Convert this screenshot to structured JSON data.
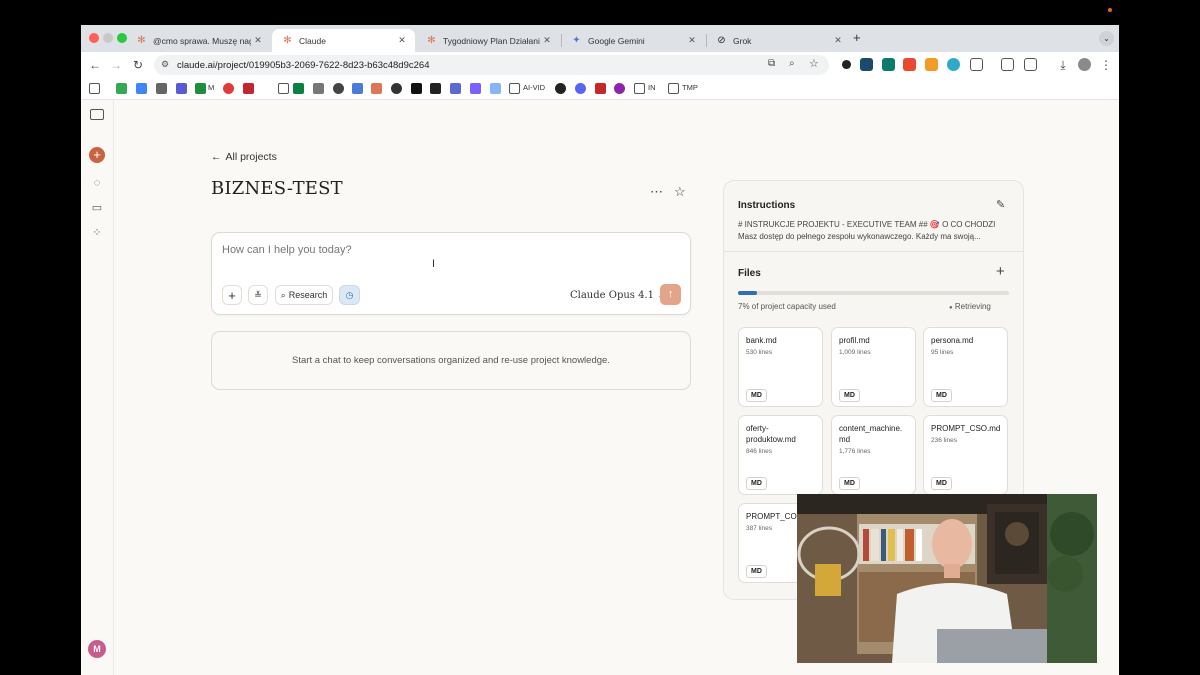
{
  "tabs": [
    {
      "title": "@cmo sprawa. Muszę nagrać",
      "icon": "claude-icon",
      "active": false
    },
    {
      "title": "Claude",
      "icon": "claude-icon",
      "active": true
    },
    {
      "title": "Tygodniowy Plan Działania - C",
      "icon": "claude-icon",
      "active": false
    },
    {
      "title": "Google Gemini",
      "icon": "gemini-icon",
      "active": false
    },
    {
      "title": "Grok",
      "icon": "grok-icon",
      "active": false
    }
  ],
  "new_tab_label": "+",
  "address": {
    "url": "claude.ai/project/019905b3-2069-7622-8d23-b63c48d9c264"
  },
  "bookmarks": {
    "m_label": "M",
    "ai_vid": "AI-VID",
    "in": "IN",
    "tmp": "TMP"
  },
  "project": {
    "back_label": "All projects",
    "title": "BIZNES-TEST",
    "composer_placeholder": "How can I help you today?",
    "research_label": "Research",
    "model_label": "Claude Opus 4.1",
    "empty_state": "Start a chat to keep conversations organized and re-use project knowledge."
  },
  "knowledge": {
    "instructions_title": "Instructions",
    "instructions_line1": "# INSTRUKCJE PROJEKTU - EXECUTIVE TEAM ## 🎯 O CO CHODZI",
    "instructions_line2": "Masz dostęp do pełnego zespołu wykonawczego. Każdy ma swoją...",
    "files_title": "Files",
    "capacity_label": "7% of project capacity used",
    "capacity_fraction": 0.07,
    "retrieving_label": "Retrieving",
    "files": [
      {
        "name": "bank.md",
        "lines": "530 lines",
        "type": "MD"
      },
      {
        "name": "profil.md",
        "lines": "1,009 lines",
        "type": "MD"
      },
      {
        "name": "persona.md",
        "lines": "95 lines",
        "type": "MD"
      },
      {
        "name": "oferty-\nproduktow.md",
        "lines": "846 lines",
        "type": "MD"
      },
      {
        "name": "content_machine.\nmd",
        "lines": "1,776 lines",
        "type": "MD"
      },
      {
        "name": "PROMPT_CSO.md",
        "lines": "236 lines",
        "type": "MD"
      },
      {
        "name": "PROMPT_CO",
        "lines": "387 lines",
        "type": "MD"
      }
    ]
  },
  "colors": {
    "accent": "#c96442",
    "send": "#e3a48c",
    "progress": "#2f6fb5"
  }
}
